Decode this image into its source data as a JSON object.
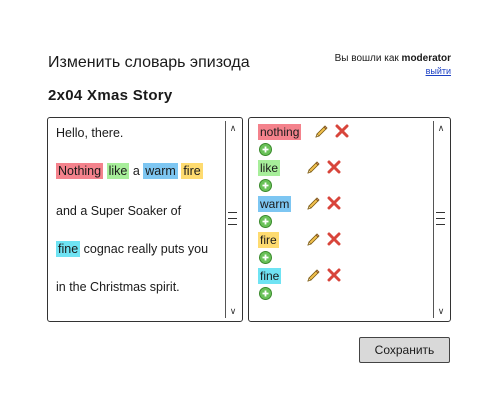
{
  "header": {
    "page_title": "Изменить словарь эпизода",
    "episode_title": "2x04 Xmas Story",
    "login_prefix": "Вы вошли как",
    "username": "moderator",
    "logout_label": "выйти"
  },
  "text_panel": {
    "line1": "Hello, there.",
    "line2": {
      "w1": "Nothing",
      "w2": "like",
      "t1": "a",
      "w3": "warm",
      "w4": "fire"
    },
    "line3": "and a Super Soaker of",
    "line4": {
      "w1": "fine",
      "rest": "cognac really puts you"
    },
    "line5": "in the Christmas spirit."
  },
  "words": [
    {
      "word": "nothing",
      "color": "#f4828c"
    },
    {
      "word": "like",
      "color": "#a7ee9a"
    },
    {
      "word": "warm",
      "color": "#7dc6f2"
    },
    {
      "word": "fire",
      "color": "#fedb70"
    },
    {
      "word": "fine",
      "color": "#6fe3f3"
    }
  ],
  "icons": {
    "edit": "pencil-icon",
    "delete": "delete-x-icon",
    "add": "add-plus-icon",
    "scroll_up": "chevron-up-icon",
    "scroll_down": "chevron-down-icon"
  },
  "save_label": "Сохранить"
}
